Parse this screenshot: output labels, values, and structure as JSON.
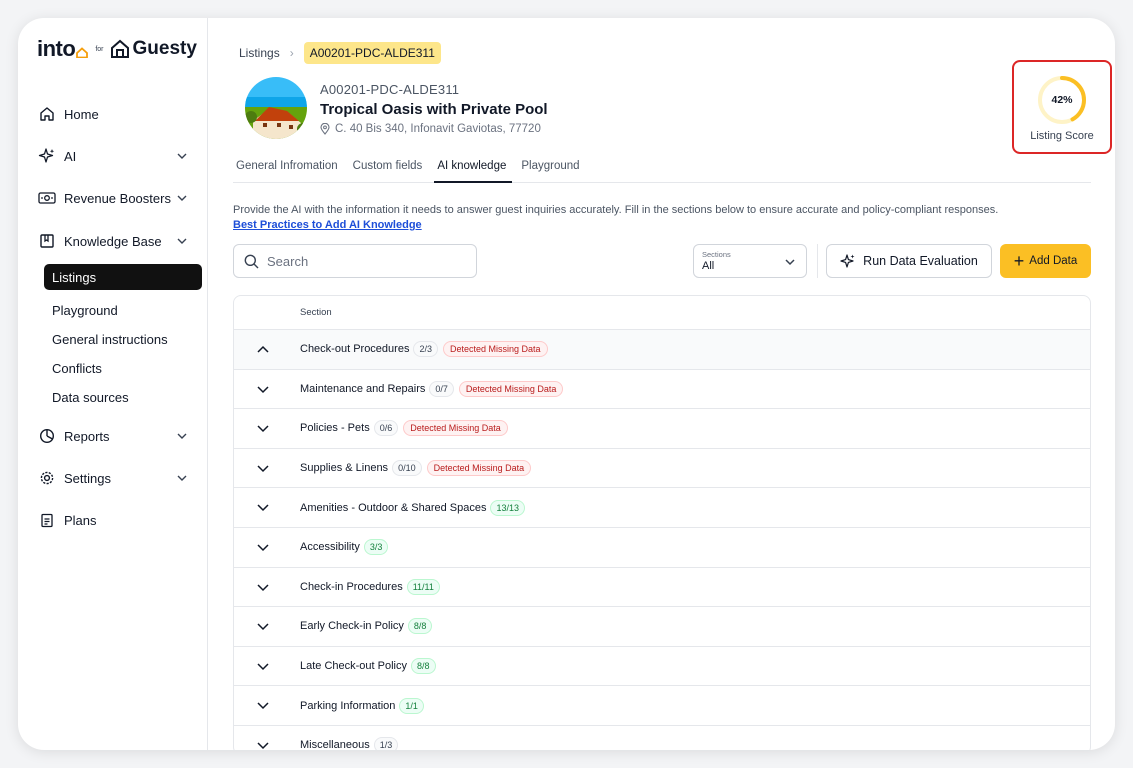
{
  "brand": {
    "into": "into",
    "for": "for",
    "guesty": "Guesty"
  },
  "nav": {
    "home": "Home",
    "ai": "AI",
    "revenue": "Revenue Boosters",
    "knowledge": "Knowledge Base",
    "sub": [
      "Listings",
      "Playground",
      "General instructions",
      "Conflicts",
      "Data sources"
    ],
    "reports": "Reports",
    "settings": "Settings",
    "plans": "Plans"
  },
  "breadcrumb": {
    "root": "Listings",
    "current": "A00201-PDC-ALDE311"
  },
  "listing": {
    "code": "A00201-PDC-ALDE311",
    "name": "Tropical Oasis with Private Pool",
    "address": "C. 40 Bis 340, Infonavit Gaviotas, 77720"
  },
  "score": {
    "value": "42%",
    "fraction": 0.42,
    "label": "Listing Score",
    "ring_color": "#fbbf24"
  },
  "tabs": [
    "General Infromation",
    "Custom fields",
    "AI knowledge",
    "Playground"
  ],
  "intro": {
    "text": "Provide the AI with the information it needs to answer guest inquiries accurately. Fill in the sections below to ensure accurate and policy-compliant responses.",
    "link": "Best Practices to Add AI Knowledge"
  },
  "toolbar": {
    "search_placeholder": "Search",
    "sections_label": "Sections",
    "sections_value": "All",
    "run_label": "Run Data Evaluation",
    "add_label": "Add Data"
  },
  "table": {
    "header": "Section",
    "missing_label": "Detected Missing Data",
    "rows": [
      {
        "name": "Check-out Procedures",
        "count": "2/3"
      },
      {
        "name": "Maintenance and Repairs",
        "count": "0/7"
      },
      {
        "name": "Policies - Pets",
        "count": "0/6"
      },
      {
        "name": "Supplies & Linens",
        "count": "0/10"
      },
      {
        "name": "Amenities - Outdoor & Shared Spaces",
        "count": "13/13"
      },
      {
        "name": "Accessibility",
        "count": "3/3"
      },
      {
        "name": "Check-in Procedures",
        "count": "11/11"
      },
      {
        "name": "Early Check-in Policy",
        "count": "8/8"
      },
      {
        "name": "Late Check-out Policy",
        "count": "8/8"
      },
      {
        "name": "Parking Information",
        "count": "1/1"
      },
      {
        "name": "Miscellaneous",
        "count": "1/3"
      }
    ]
  },
  "colors": {
    "accent": "#fbbf24",
    "active_nav": "#111111",
    "missing": "#b91c1c",
    "complete": "#15803d",
    "highlight": "#dc2626"
  }
}
